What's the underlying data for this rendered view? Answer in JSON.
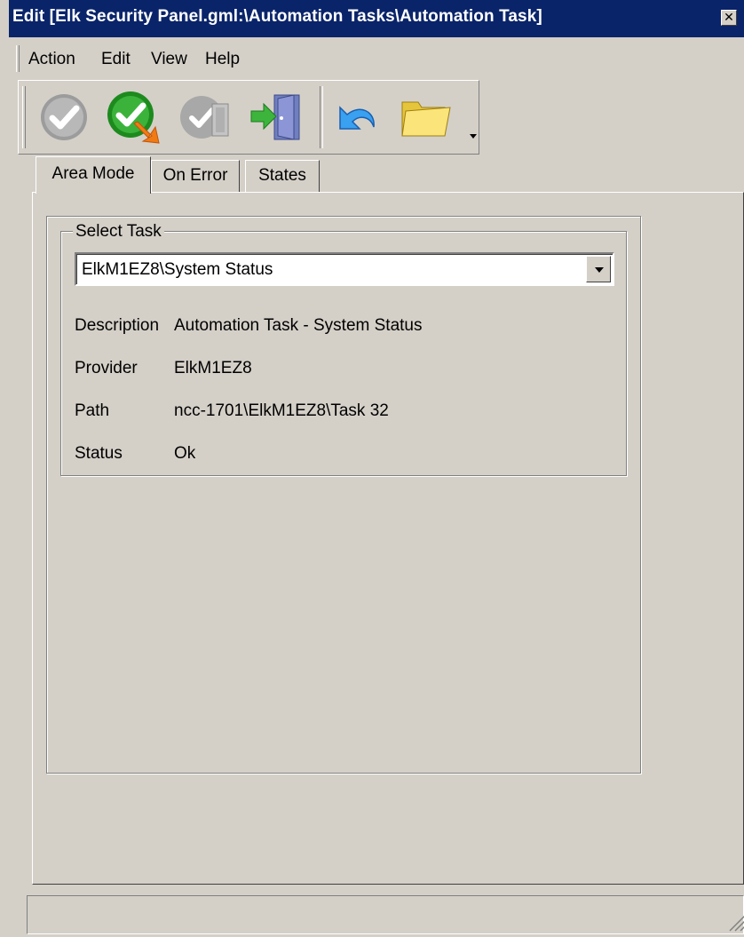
{
  "window": {
    "title": "Edit [Elk Security Panel.gml:\\Automation Tasks\\Automation Task]",
    "close_symbol": "✕"
  },
  "menu": {
    "items": [
      "Action",
      "Edit",
      "View",
      "Help"
    ]
  },
  "toolbar": {
    "buttons": [
      "check-disabled-icon",
      "apply-icon",
      "check-door-disabled-icon",
      "exit-door-icon",
      "undo-icon",
      "folder-icon"
    ]
  },
  "tabs": [
    {
      "label": "Area Mode",
      "active": true
    },
    {
      "label": "On Error",
      "active": false
    },
    {
      "label": "States",
      "active": false
    }
  ],
  "select_task": {
    "legend": "Select Task",
    "value": "ElkM1EZ8\\System Status"
  },
  "details": {
    "description_label": "Description",
    "description_value": "Automation Task - System Status",
    "provider_label": "Provider",
    "provider_value": "ElkM1EZ8",
    "path_label": "Path",
    "path_value": "ncc-1701\\ElkM1EZ8\\Task 32",
    "status_label": "Status",
    "status_value": "Ok"
  }
}
